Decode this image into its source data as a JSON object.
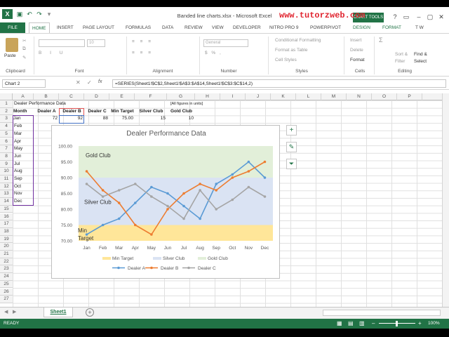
{
  "window": {
    "title": "Banded line charts.xlsx - Microsoft Excel",
    "watermark": "www.tutorzweb.com",
    "context_tab": "CHART TOOLS",
    "user": "T W"
  },
  "tabs": [
    "FILE",
    "HOME",
    "INSERT",
    "PAGE LAYOUT",
    "FORMULAS",
    "DATA",
    "REVIEW",
    "VIEW",
    "DEVELOPER",
    "NITRO PRO 9",
    "POWERPIVOT",
    "DESIGN",
    "FORMAT"
  ],
  "ribbon": {
    "paste": "Paste",
    "groups": [
      "Clipboard",
      "Font",
      "Alignment",
      "Number",
      "Styles",
      "Cells",
      "Editing"
    ],
    "font_size": "10",
    "number_format": "General",
    "cond_format": "Conditional Formatting",
    "format_table": "Format as Table",
    "cell_styles": "Cell Styles",
    "insert": "Insert",
    "delete": "Delete",
    "format": "Format",
    "sort": "Sort &",
    "filter": "Filter",
    "find": "Find &",
    "select": "Select"
  },
  "formula_bar": {
    "name_box": "Chart 2",
    "fx": "fx",
    "formula": "=SERIES(Sheet1!$C$2,Sheet1!$A$3:$A$14,Sheet1!$C$3:$C$14,2)"
  },
  "columns": [
    "A",
    "B",
    "C",
    "D",
    "E",
    "F",
    "G",
    "H",
    "I",
    "J",
    "K",
    "L",
    "M",
    "N",
    "O",
    "P"
  ],
  "rows": [
    "1",
    "2",
    "3",
    "4",
    "5",
    "6",
    "7",
    "8",
    "9",
    "10",
    "11",
    "12",
    "13",
    "14",
    "15",
    "16",
    "17",
    "18",
    "19",
    "20",
    "21",
    "22",
    "23",
    "24",
    "25",
    "26",
    "27"
  ],
  "sheet": {
    "a1": "Dealer Performance Data",
    "f1": "[All figures in units]",
    "headers": [
      "Month",
      "Dealer A",
      "Dealer B",
      "Dealer C",
      "Min Target",
      "Silver Club",
      "Gold Club"
    ],
    "row3": [
      "Jan",
      "72",
      "92",
      "88",
      "75.00",
      "15",
      "10"
    ],
    "months": [
      "Feb",
      "Mar",
      "Apr",
      "May",
      "Jun",
      "Jul",
      "Aug",
      "Sep",
      "Oct",
      "Nov",
      "Dec"
    ]
  },
  "chart_data": {
    "type": "line",
    "title": "Dealer Performance Data",
    "categories": [
      "Jan",
      "Feb",
      "Mar",
      "Apr",
      "May",
      "Jun",
      "Jul",
      "Aug",
      "Sep",
      "Oct",
      "Nov",
      "Dec"
    ],
    "ylim": [
      70,
      100
    ],
    "yticks": [
      "70.00",
      "75.00",
      "80.00",
      "85.00",
      "90.00",
      "95.00",
      "100.00"
    ],
    "bands": [
      {
        "name": "Min Target",
        "from": 70,
        "to": 75,
        "color": "#ffe699",
        "label": "Min Target"
      },
      {
        "name": "Silver Club",
        "from": 75,
        "to": 90,
        "color": "#dae3f3",
        "label": "Silver Club"
      },
      {
        "name": "Gold Club",
        "from": 90,
        "to": 100,
        "color": "#e2efd9",
        "label": "Gold Club"
      }
    ],
    "series": [
      {
        "name": "Dealer A",
        "color": "#5b9bd5",
        "values": [
          72,
          75,
          77,
          82,
          87,
          85,
          81,
          77,
          88,
          91,
          95,
          90
        ]
      },
      {
        "name": "Dealer B",
        "color": "#ed7d31",
        "values": [
          92,
          86,
          82,
          75,
          72,
          80,
          85,
          88,
          86,
          90,
          92,
          95
        ]
      },
      {
        "name": "Dealer C",
        "color": "#a5a5a5",
        "values": [
          88,
          84,
          86,
          88,
          84,
          81,
          77,
          86,
          80,
          83,
          87,
          84
        ]
      }
    ],
    "legend_position": "bottom"
  },
  "sheet_tab": "Sheet1",
  "status": {
    "ready": "READY",
    "zoom": "100%"
  }
}
